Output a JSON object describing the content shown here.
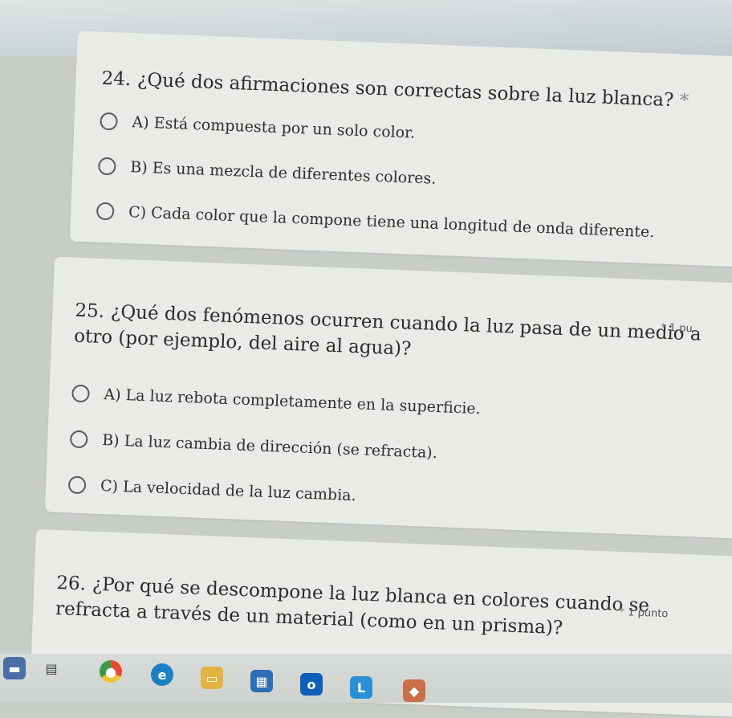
{
  "questions": [
    {
      "number": "24.",
      "text": "¿Qué dos afirmaciones son correctas sobre la luz blanca?",
      "required": "*",
      "options": [
        {
          "letter": "A)",
          "text": "Está compuesta por un solo color."
        },
        {
          "letter": "B)",
          "text": "Es una mezcla de diferentes colores."
        },
        {
          "letter": "C)",
          "text": "Cada color que la compone tiene una longitud de onda diferente."
        }
      ]
    },
    {
      "number": "25.",
      "line1": "¿Qué dos fenómenos ocurren cuando la luz pasa de un medio a",
      "line2": "otro (por ejemplo, del aire al agua)?",
      "required": "*",
      "points": "1 pu",
      "options": [
        {
          "letter": "A)",
          "text": "La luz rebota completamente en la superficie."
        },
        {
          "letter": "B)",
          "text": "La luz cambia de dirección (se refracta)."
        },
        {
          "letter": "C)",
          "text": "La velocidad de la luz cambia."
        }
      ]
    },
    {
      "number": "26.",
      "line1": "¿Por qué se descompone la luz blanca en colores cuando se",
      "line2": "refracta a través de un material (como en un prisma)?",
      "required": "*",
      "points": "1 punto"
    }
  ],
  "taskbar": {
    "icons": [
      {
        "name": "photos-icon",
        "color": "#4a6fa5"
      },
      {
        "name": "task-view-icon",
        "color": "#6b6b6b"
      },
      {
        "name": "chrome-icon",
        "color": "#e0a020"
      },
      {
        "name": "edge-icon",
        "color": "#1b7fc4"
      },
      {
        "name": "file-explorer-icon",
        "color": "#e3b341"
      },
      {
        "name": "store-icon",
        "color": "#2f6db5"
      },
      {
        "name": "outlook-icon",
        "color": "#0f5fb8"
      },
      {
        "name": "l-app-icon",
        "color": "#2a8fd6"
      },
      {
        "name": "app-icon",
        "color": "#c9704a"
      }
    ]
  }
}
